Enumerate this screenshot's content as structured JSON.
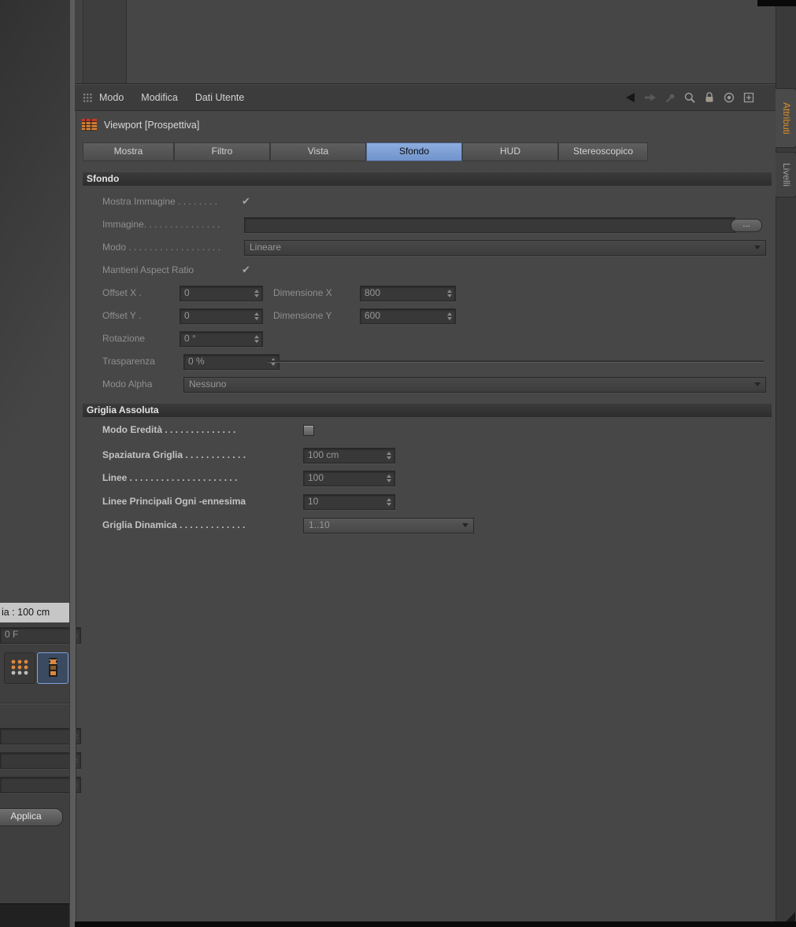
{
  "colors": {
    "tab_active": "#7d9fd6",
    "accent_orange": "#e0873a",
    "attributi_text": "#d78c28"
  },
  "icons": {
    "checkmark": "✔",
    "browse": "..."
  },
  "left_panel": {
    "grid_status": "ia : 100 cm",
    "frame_value": "0 F",
    "apply_label": "Applica"
  },
  "attribute_manager": {
    "menu_items": [
      "Modo",
      "Modifica",
      "Dati Utente"
    ],
    "object_title": "Viewport [Prospettiva]",
    "tabs": [
      "Mostra",
      "Filtro",
      "Vista",
      "Sfondo",
      "HUD",
      "Stereoscopico"
    ],
    "active_tab": "Sfondo",
    "sfondo": {
      "header": "Sfondo",
      "mostra_immagine_label": "Mostra Immagine . . . . . . . .",
      "immagine_label": "Immagine. . . . . . . . . . . . . . .",
      "immagine_value": "",
      "modo_label": "Modo . . . . . . . . . . . . . . . . . .",
      "modo_value": "Lineare",
      "aspect_label": "Mantieni Aspect Ratio",
      "offset_x_label": "Offset X .",
      "offset_x_value": "0",
      "dimensione_x_label": "Dimensione X",
      "dimensione_x_value": "800",
      "offset_y_label": "Offset Y .",
      "offset_y_value": "0",
      "dimensione_y_label": "Dimensione Y",
      "dimensione_y_value": "600",
      "rotazione_label": "Rotazione",
      "rotazione_value": "0 °",
      "trasparenza_label": "Trasparenza",
      "trasparenza_value": "0 %",
      "modo_alpha_label": "Modo Alpha",
      "modo_alpha_value": "Nessuno"
    },
    "griglia": {
      "header": "Griglia Assoluta",
      "modo_eredita_label": "Modo Eredità . . . . . . . . . . . . . .",
      "spaziatura_label": "Spaziatura Griglia . . . . . . . . . . . .",
      "spaziatura_value": "100 cm",
      "linee_label": "Linee  . . . . . . . . . . . . . . . . . . . . .",
      "linee_value": "100",
      "linee_principali_label": "Linee Principali Ogni -ennesima",
      "linee_principali_value": "10",
      "griglia_dinamica_label": "Griglia Dinamica . . . . . . . . . . . . .",
      "griglia_dinamica_value": "1..10"
    }
  },
  "side_tabs": [
    {
      "label": "Attributi"
    },
    {
      "label": "Livelli"
    }
  ]
}
